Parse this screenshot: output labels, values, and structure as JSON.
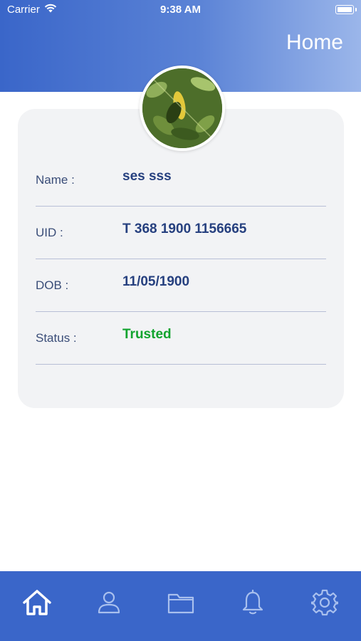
{
  "status_bar": {
    "carrier": "Carrier",
    "time": "9:38 AM"
  },
  "header": {
    "title": "Home"
  },
  "profile": {
    "avatar_icon": "profile-photo",
    "rows": [
      {
        "label": "Name :",
        "value": "ses sss"
      },
      {
        "label": "UID :",
        "value": "T 368 1900 1156665"
      },
      {
        "label": "DOB :",
        "value": "11/05/1900"
      },
      {
        "label": "Status :",
        "value": "Trusted"
      }
    ]
  },
  "tabbar": {
    "items": [
      {
        "icon": "home-icon",
        "active": true
      },
      {
        "icon": "user-icon",
        "active": false
      },
      {
        "icon": "folder-icon",
        "active": false
      },
      {
        "icon": "bell-icon",
        "active": false
      },
      {
        "icon": "gear-icon",
        "active": false
      }
    ]
  },
  "colors": {
    "header_start": "#3a66c9",
    "header_end": "#9bb6ea",
    "tabbar": "#3a66c9",
    "value_text": "#26407f",
    "status_trusted": "#11a32e"
  }
}
